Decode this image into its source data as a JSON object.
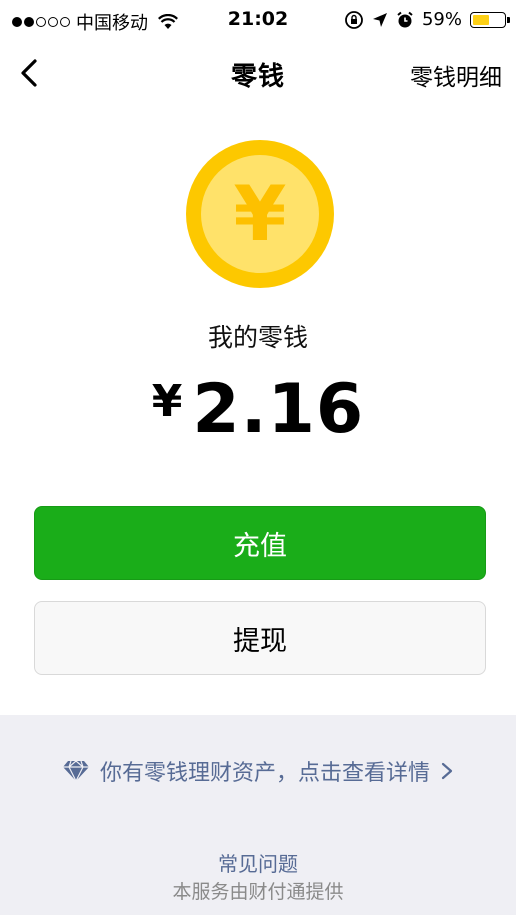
{
  "status_bar": {
    "carrier": "中国移动",
    "time": "21:02",
    "battery_percent": "59%",
    "battery_level": 0.59,
    "icons": [
      "signal-dots-icon",
      "wifi-icon",
      "rotation-lock-icon",
      "location-arrow-icon",
      "alarm-icon",
      "battery-icon"
    ]
  },
  "nav": {
    "title": "零钱",
    "right_link": "零钱明细",
    "back_icon": "chevron-left-icon"
  },
  "wallet": {
    "coin_symbol": "¥",
    "label": "我的零钱",
    "currency": "¥",
    "amount": "2.16"
  },
  "buttons": {
    "recharge": "充值",
    "withdraw": "提现"
  },
  "footer": {
    "wealth_link": "你有零钱理财资产，点击查看详情",
    "faq": "常见问题",
    "provider": "本服务由财付通提供"
  },
  "colors": {
    "primary_green": "#1aad19",
    "link_blue": "#576b95",
    "coin_gold": "#fdc800",
    "footer_bg": "#efeff4"
  }
}
